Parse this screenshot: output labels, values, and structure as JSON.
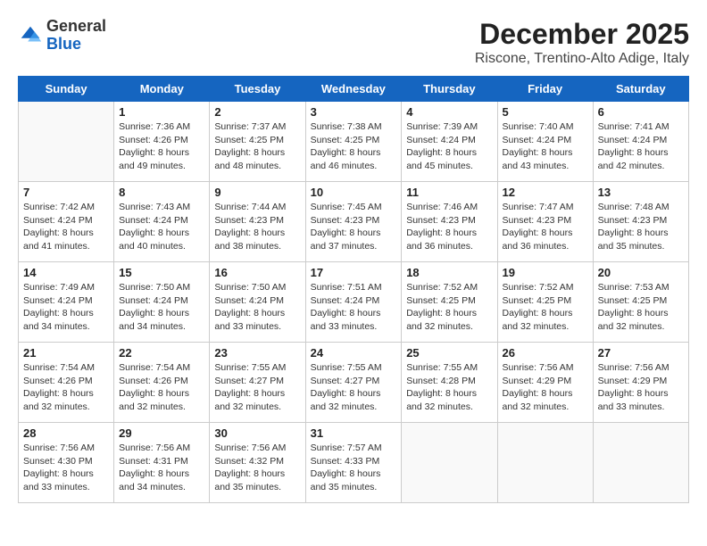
{
  "header": {
    "logo_general": "General",
    "logo_blue": "Blue",
    "month_year": "December 2025",
    "location": "Riscone, Trentino-Alto Adige, Italy"
  },
  "days_of_week": [
    "Sunday",
    "Monday",
    "Tuesday",
    "Wednesday",
    "Thursday",
    "Friday",
    "Saturday"
  ],
  "weeks": [
    [
      {
        "day": null
      },
      {
        "day": "1",
        "sunrise": "Sunrise: 7:36 AM",
        "sunset": "Sunset: 4:26 PM",
        "daylight": "Daylight: 8 hours and 49 minutes."
      },
      {
        "day": "2",
        "sunrise": "Sunrise: 7:37 AM",
        "sunset": "Sunset: 4:25 PM",
        "daylight": "Daylight: 8 hours and 48 minutes."
      },
      {
        "day": "3",
        "sunrise": "Sunrise: 7:38 AM",
        "sunset": "Sunset: 4:25 PM",
        "daylight": "Daylight: 8 hours and 46 minutes."
      },
      {
        "day": "4",
        "sunrise": "Sunrise: 7:39 AM",
        "sunset": "Sunset: 4:24 PM",
        "daylight": "Daylight: 8 hours and 45 minutes."
      },
      {
        "day": "5",
        "sunrise": "Sunrise: 7:40 AM",
        "sunset": "Sunset: 4:24 PM",
        "daylight": "Daylight: 8 hours and 43 minutes."
      },
      {
        "day": "6",
        "sunrise": "Sunrise: 7:41 AM",
        "sunset": "Sunset: 4:24 PM",
        "daylight": "Daylight: 8 hours and 42 minutes."
      }
    ],
    [
      {
        "day": "7",
        "sunrise": "Sunrise: 7:42 AM",
        "sunset": "Sunset: 4:24 PM",
        "daylight": "Daylight: 8 hours and 41 minutes."
      },
      {
        "day": "8",
        "sunrise": "Sunrise: 7:43 AM",
        "sunset": "Sunset: 4:24 PM",
        "daylight": "Daylight: 8 hours and 40 minutes."
      },
      {
        "day": "9",
        "sunrise": "Sunrise: 7:44 AM",
        "sunset": "Sunset: 4:23 PM",
        "daylight": "Daylight: 8 hours and 38 minutes."
      },
      {
        "day": "10",
        "sunrise": "Sunrise: 7:45 AM",
        "sunset": "Sunset: 4:23 PM",
        "daylight": "Daylight: 8 hours and 37 minutes."
      },
      {
        "day": "11",
        "sunrise": "Sunrise: 7:46 AM",
        "sunset": "Sunset: 4:23 PM",
        "daylight": "Daylight: 8 hours and 36 minutes."
      },
      {
        "day": "12",
        "sunrise": "Sunrise: 7:47 AM",
        "sunset": "Sunset: 4:23 PM",
        "daylight": "Daylight: 8 hours and 36 minutes."
      },
      {
        "day": "13",
        "sunrise": "Sunrise: 7:48 AM",
        "sunset": "Sunset: 4:23 PM",
        "daylight": "Daylight: 8 hours and 35 minutes."
      }
    ],
    [
      {
        "day": "14",
        "sunrise": "Sunrise: 7:49 AM",
        "sunset": "Sunset: 4:24 PM",
        "daylight": "Daylight: 8 hours and 34 minutes."
      },
      {
        "day": "15",
        "sunrise": "Sunrise: 7:50 AM",
        "sunset": "Sunset: 4:24 PM",
        "daylight": "Daylight: 8 hours and 34 minutes."
      },
      {
        "day": "16",
        "sunrise": "Sunrise: 7:50 AM",
        "sunset": "Sunset: 4:24 PM",
        "daylight": "Daylight: 8 hours and 33 minutes."
      },
      {
        "day": "17",
        "sunrise": "Sunrise: 7:51 AM",
        "sunset": "Sunset: 4:24 PM",
        "daylight": "Daylight: 8 hours and 33 minutes."
      },
      {
        "day": "18",
        "sunrise": "Sunrise: 7:52 AM",
        "sunset": "Sunset: 4:25 PM",
        "daylight": "Daylight: 8 hours and 32 minutes."
      },
      {
        "day": "19",
        "sunrise": "Sunrise: 7:52 AM",
        "sunset": "Sunset: 4:25 PM",
        "daylight": "Daylight: 8 hours and 32 minutes."
      },
      {
        "day": "20",
        "sunrise": "Sunrise: 7:53 AM",
        "sunset": "Sunset: 4:25 PM",
        "daylight": "Daylight: 8 hours and 32 minutes."
      }
    ],
    [
      {
        "day": "21",
        "sunrise": "Sunrise: 7:54 AM",
        "sunset": "Sunset: 4:26 PM",
        "daylight": "Daylight: 8 hours and 32 minutes."
      },
      {
        "day": "22",
        "sunrise": "Sunrise: 7:54 AM",
        "sunset": "Sunset: 4:26 PM",
        "daylight": "Daylight: 8 hours and 32 minutes."
      },
      {
        "day": "23",
        "sunrise": "Sunrise: 7:55 AM",
        "sunset": "Sunset: 4:27 PM",
        "daylight": "Daylight: 8 hours and 32 minutes."
      },
      {
        "day": "24",
        "sunrise": "Sunrise: 7:55 AM",
        "sunset": "Sunset: 4:27 PM",
        "daylight": "Daylight: 8 hours and 32 minutes."
      },
      {
        "day": "25",
        "sunrise": "Sunrise: 7:55 AM",
        "sunset": "Sunset: 4:28 PM",
        "daylight": "Daylight: 8 hours and 32 minutes."
      },
      {
        "day": "26",
        "sunrise": "Sunrise: 7:56 AM",
        "sunset": "Sunset: 4:29 PM",
        "daylight": "Daylight: 8 hours and 32 minutes."
      },
      {
        "day": "27",
        "sunrise": "Sunrise: 7:56 AM",
        "sunset": "Sunset: 4:29 PM",
        "daylight": "Daylight: 8 hours and 33 minutes."
      }
    ],
    [
      {
        "day": "28",
        "sunrise": "Sunrise: 7:56 AM",
        "sunset": "Sunset: 4:30 PM",
        "daylight": "Daylight: 8 hours and 33 minutes."
      },
      {
        "day": "29",
        "sunrise": "Sunrise: 7:56 AM",
        "sunset": "Sunset: 4:31 PM",
        "daylight": "Daylight: 8 hours and 34 minutes."
      },
      {
        "day": "30",
        "sunrise": "Sunrise: 7:56 AM",
        "sunset": "Sunset: 4:32 PM",
        "daylight": "Daylight: 8 hours and 35 minutes."
      },
      {
        "day": "31",
        "sunrise": "Sunrise: 7:57 AM",
        "sunset": "Sunset: 4:33 PM",
        "daylight": "Daylight: 8 hours and 35 minutes."
      },
      {
        "day": null
      },
      {
        "day": null
      },
      {
        "day": null
      }
    ]
  ]
}
